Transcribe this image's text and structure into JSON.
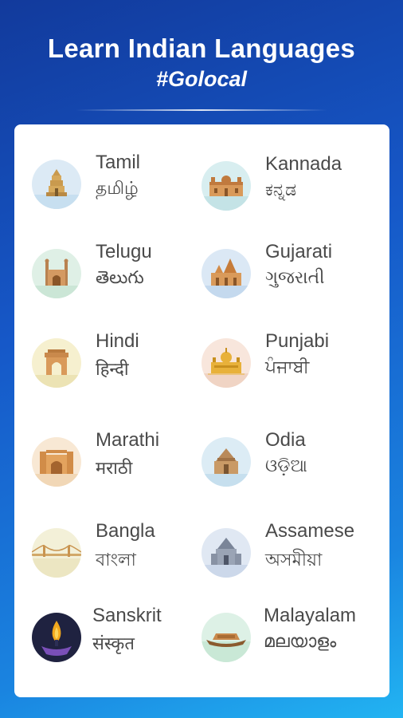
{
  "header": {
    "title": "Learn Indian Languages",
    "subtitle": "#Golocal"
  },
  "languages": [
    {
      "name": "Tamil",
      "native": "தமிழ்",
      "icon": "temple-icon",
      "bg": "#dceaf5"
    },
    {
      "name": "Kannada",
      "native": "ಕನ್ನಡ",
      "icon": "palace-icon",
      "bg": "#d8eef0"
    },
    {
      "name": "Telugu",
      "native": "తెలుగు",
      "icon": "charminar-icon",
      "bg": "#dff0e6"
    },
    {
      "name": "Gujarati",
      "native": "ગુજરાતી",
      "icon": "gujarat-temple-icon",
      "bg": "#dbe8f5"
    },
    {
      "name": "Hindi",
      "native": "हिन्दी",
      "icon": "india-gate-icon",
      "bg": "#f6f0cf"
    },
    {
      "name": "Punjabi",
      "native": "ਪੰਜਾਬੀ",
      "icon": "golden-temple-icon",
      "bg": "#f8e6dc"
    },
    {
      "name": "Marathi",
      "native": "मराठी",
      "icon": "gateway-of-india-icon",
      "bg": "#f8e8d4"
    },
    {
      "name": "Odia",
      "native": "ଓଡ଼ିଆ",
      "icon": "sun-temple-icon",
      "bg": "#dcecf5"
    },
    {
      "name": "Bangla",
      "native": "বাংলা",
      "icon": "bridge-icon",
      "bg": "#f3f0d8"
    },
    {
      "name": "Assamese",
      "native": "অসমীয়া",
      "icon": "assam-temple-icon",
      "bg": "#e0e8f3"
    },
    {
      "name": "Sanskrit",
      "native": "संस्कृत",
      "icon": "diya-flame-icon",
      "bg": "#1f2240"
    },
    {
      "name": "Malayalam",
      "native": "മലയാളം",
      "icon": "houseboat-icon",
      "bg": "#ddf1e6"
    }
  ],
  "colors": {
    "background_top": "#123a9c",
    "background_bottom": "#22b4f2",
    "card": "#ffffff",
    "text": "#4a4a4a"
  }
}
